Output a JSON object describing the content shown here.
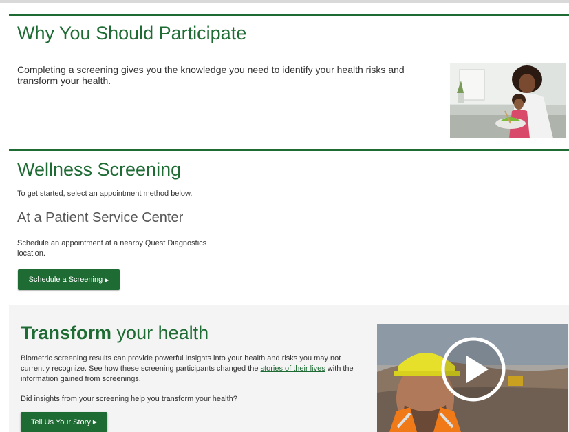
{
  "section_participate": {
    "title": "Why You Should Participate",
    "text": "Completing a screening gives you the knowledge you need to identify your health risks and transform your health."
  },
  "section_wellness": {
    "title": "Wellness Screening",
    "intro": "To get started, select an appointment method below.",
    "subtitle": "At a Patient Service Center",
    "description": "Schedule an appointment at a nearby Quest Diagnostics location.",
    "button_label": "Schedule a Screening"
  },
  "section_transform": {
    "title_bold": "Transform",
    "title_rest": " your health",
    "text_before": "Biometric screening results can provide powerful insights into your health and risks you may not currently recognize. See how these screening participants changed the ",
    "link_text": "stories of their lives",
    "text_after": " with the information gained from screenings.",
    "question": "Did insights from your screening help you transform your health?",
    "button_label": "Tell Us Your Story"
  },
  "icons": {
    "caret": "caret-right-icon",
    "play": "play-icon"
  },
  "colors": {
    "brand_green": "#1e6b34",
    "panel_bg": "#f4f4f4"
  }
}
